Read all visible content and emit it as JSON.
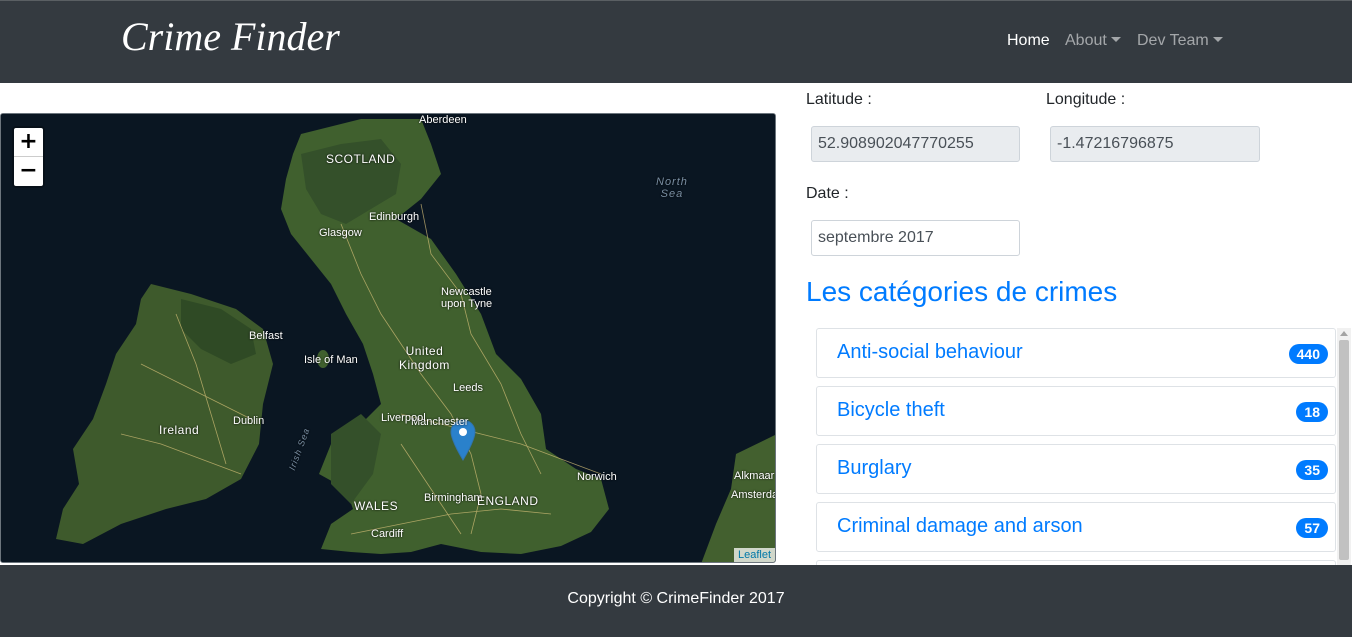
{
  "navbar": {
    "brand": "Crime Finder",
    "links": [
      {
        "label": "Home",
        "active": true
      },
      {
        "label": "About",
        "dropdown": true
      },
      {
        "label": "Dev Team",
        "dropdown": true
      }
    ]
  },
  "map": {
    "zoom_in": "+",
    "zoom_out": "−",
    "attribution": "Leaflet",
    "labels": {
      "scotland": "SCOTLAND",
      "united_kingdom": "United\nKingdom",
      "ireland": "Ireland",
      "isle_of_man": "Isle of Man",
      "england": "ENGLAND",
      "wales": "WALES",
      "north_sea": "North\nSea",
      "irish_sea": "Irish Sea",
      "aberdeen": "Aberdeen",
      "edinburgh": "Edinburgh",
      "glasgow": "Glasgow",
      "newcastle": "Newcastle\nupon Tyne",
      "belfast": "Belfast",
      "dublin": "Dublin",
      "leeds": "Leeds",
      "manchester": "Manchester",
      "liverpool": "Liverpool",
      "birmingham": "Birmingham",
      "cardiff": "Cardiff",
      "norwich": "Norwich",
      "alkmaar": "Alkmaar",
      "amsterdam": "Amsterdam"
    },
    "marker": {
      "lat": 52.908902047770255,
      "lng": -1.47216796875
    },
    "colors": {
      "sea": "#0a1622",
      "land": "#3d5a2a",
      "roads": "#d9c27a",
      "marker": "#2a81cb"
    }
  },
  "form": {
    "latitude_label": "Latitude :",
    "latitude_value": "52.908902047770255",
    "longitude_label": "Longitude :",
    "longitude_value": "-1.47216796875",
    "date_label": "Date :",
    "date_value": "septembre 2017"
  },
  "categories": {
    "title": "Les catégories de crimes",
    "items": [
      {
        "name": "Anti-social behaviour",
        "count": "440"
      },
      {
        "name": "Bicycle theft",
        "count": "18"
      },
      {
        "name": "Burglary",
        "count": "35"
      },
      {
        "name": "Criminal damage and arson",
        "count": "57"
      },
      {
        "name": "",
        "count": ""
      }
    ]
  },
  "footer": {
    "copyright": "Copyright © CrimeFinder 2017"
  },
  "colors": {
    "navbar": "#343a40",
    "accent": "#007bff"
  }
}
